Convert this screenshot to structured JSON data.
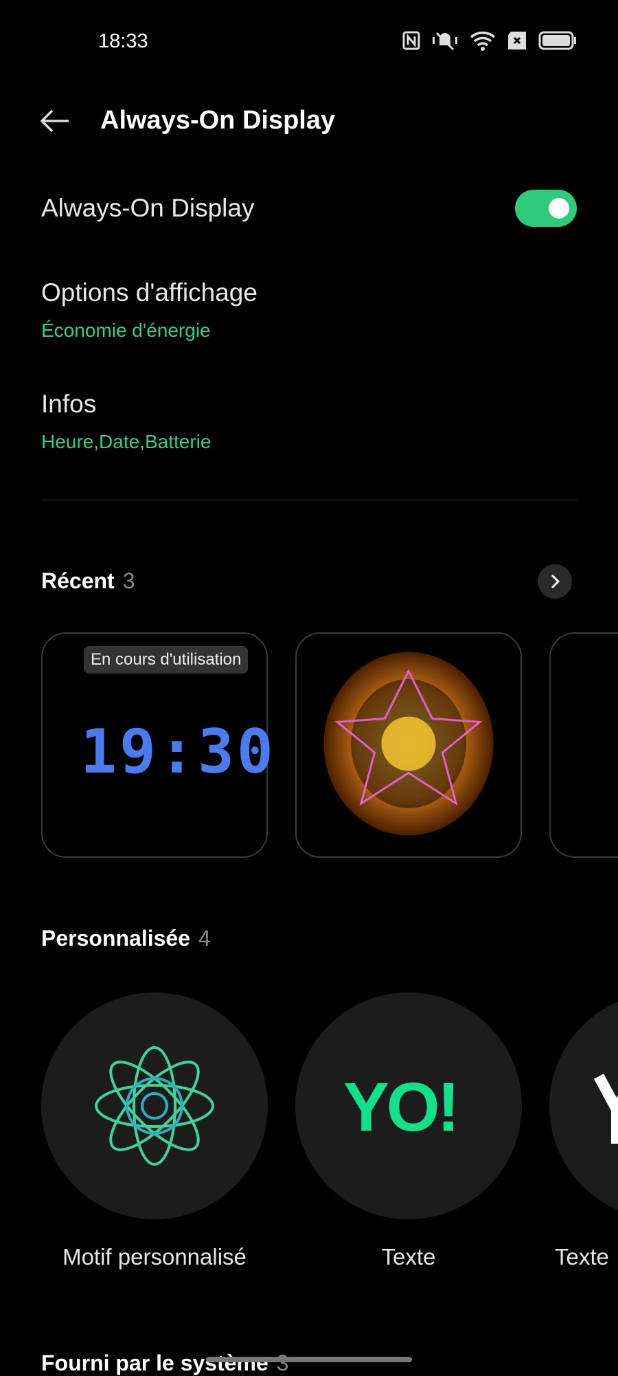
{
  "status_bar": {
    "time": "18:33",
    "icons": [
      "nfc-icon",
      "vibrate-silent-icon",
      "wifi-icon",
      "sim-missing-icon",
      "battery-icon"
    ]
  },
  "header": {
    "title": "Always-On Display",
    "back_icon": "arrow-left-icon"
  },
  "settings": {
    "aod": {
      "label": "Always-On Display",
      "enabled": true
    },
    "display_options": {
      "label": "Options d'affichage",
      "value": "Économie d'énergie"
    },
    "info": {
      "label": "Infos",
      "value": "Heure,Date,Batterie"
    }
  },
  "recent": {
    "title": "Récent",
    "count": "3",
    "badge": "En cours d'utilisation",
    "clock_preview": "19:30"
  },
  "custom": {
    "title": "Personnalisée",
    "count": "4",
    "items": [
      {
        "label": "Motif personnalisé"
      },
      {
        "label": "Texte",
        "preview": "YO!"
      },
      {
        "label": "Texte"
      }
    ]
  },
  "system": {
    "title": "Fourni par le système",
    "count": "3"
  },
  "colors": {
    "accent": "#2fcf7e",
    "toggle": "#2ecc7a",
    "clock_blue": "#4a7cf0"
  }
}
